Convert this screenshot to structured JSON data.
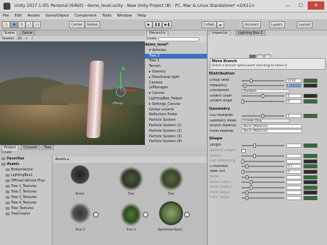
{
  "window": {
    "title": "Unity 2017.1.0f1 Personal (64bit) - demo_level.unity - New Unity Project (8) - PC, Mac & Linux Standalone* <DX11>",
    "buttons": [
      "—",
      "☐",
      "✕"
    ]
  },
  "menu": [
    "File",
    "Edit",
    "Assets",
    "GameObject",
    "Component",
    "Tools",
    "Window",
    "Help"
  ],
  "toolbar": {
    "pivot_label": "Center",
    "space_label": "Global",
    "collab_label": "Collab",
    "account_label": "Account",
    "layers_label": "Layers",
    "layout_label": "Layout"
  },
  "scene": {
    "tabs": [
      "Scene",
      "Game"
    ],
    "shading": "Shaded",
    "mode": "2D",
    "gizmo_label": "<Persp"
  },
  "hierarchy": {
    "tab": "Hierarchy",
    "create_label": "Create",
    "scene_name": "demo_level*",
    "items": [
      {
        "label": "▾ Vehicles",
        "selected": false
      },
      {
        "label": "Tree 2",
        "selected": true
      },
      {
        "label": "Tree 1",
        "selected": false
      },
      {
        "label": "Terrain",
        "selected": false
      },
      {
        "label": "▸ Scenery",
        "selected": false
      },
      {
        "label": "▸ Directional light",
        "selected": false
      },
      {
        "label": "Camera",
        "selected": false
      },
      {
        "label": "LVManager",
        "selected": false
      },
      {
        "label": "▸ Canvas",
        "selected": false
      },
      {
        "label": "LightingBox_Helper",
        "selected": false
      },
      {
        "label": "▸ Settings_Canvas",
        "selected": false
      },
      {
        "label": "Global volume",
        "selected": false
      },
      {
        "label": "Reflection Probe",
        "selected": false
      },
      {
        "label": "Particle System",
        "selected": false
      },
      {
        "label": "Particle System (1)",
        "selected": false
      },
      {
        "label": "Particle System (2)",
        "selected": false
      },
      {
        "label": "Particle System (3)",
        "selected": false
      },
      {
        "label": "Particle System (4)",
        "selected": false
      }
    ]
  },
  "inspector": {
    "tabs": [
      "Inspector",
      "Lighting Box 2"
    ],
    "branch_box": {
      "title": "Move Branch",
      "desc": "Select a branch spline point and drag to move it."
    },
    "distribution": {
      "title": "Distribution",
      "rows": [
        {
          "label": "Group Seed",
          "value": "1234",
          "kind": "slider",
          "knob": 0.2
        },
        {
          "label": "Frequency",
          "value": "1",
          "kind": "slider",
          "knob": 0.05,
          "highlight": true
        },
        {
          "label": "Distribution",
          "value": "Random",
          "kind": "dropdown"
        },
        {
          "label": "Growth Scale",
          "value": "1",
          "kind": "slider",
          "knob": 0.5
        },
        {
          "label": "Growth Angle",
          "value": "0",
          "kind": "slider",
          "knob": 0.0
        }
      ]
    },
    "geometry": {
      "title": "Geometry",
      "rows": [
        {
          "label": "LOD Multiplier",
          "value": "1",
          "kind": "slider",
          "knob": 0.5
        },
        {
          "label": "Geometry Mode",
          "value": "Fronds Only",
          "kind": "dropdown"
        },
        {
          "label": "Branch Material",
          "value": "None (Material)",
          "kind": "object"
        },
        {
          "label": "Frond Material",
          "value": "None (Material)",
          "kind": "object"
        }
      ]
    },
    "shape": {
      "title": "Shape",
      "rows": [
        {
          "label": "Length",
          "value": "",
          "kind": "slider",
          "knob": 0.3,
          "dim": false
        },
        {
          "label": "Relative Length",
          "value": "",
          "kind": "check",
          "dim": true
        },
        {
          "label": "Radius",
          "value": "",
          "kind": "slider",
          "knob": 0.3,
          "dim": true
        },
        {
          "label": "Cap Smoothing",
          "value": "",
          "kind": "slider",
          "knob": 0.0,
          "dim": true
        },
        {
          "label": "Crinkliness",
          "value": "0.1",
          "kind": "slider",
          "knob": 0.1,
          "dim": false
        },
        {
          "label": "Seek Sun",
          "value": "0",
          "kind": "slider",
          "knob": 0.0,
          "dim": false
        },
        {
          "label": "Noise",
          "value": "",
          "kind": "slider",
          "knob": 0.1,
          "dim": true
        },
        {
          "label": "Noise Scale U",
          "value": "",
          "kind": "slider",
          "knob": 0.2,
          "dim": true
        },
        {
          "label": "Noise Scale V",
          "value": "",
          "kind": "slider",
          "knob": 0.2,
          "dim": true
        },
        {
          "label": "Flare Radius",
          "value": "",
          "kind": "slider",
          "knob": 0.1,
          "dim": true
        },
        {
          "label": "Flare Height",
          "value": "",
          "kind": "slider",
          "knob": 0.1,
          "dim": true
        }
      ]
    }
  },
  "project": {
    "tabs": [
      "Project",
      "Console",
      "Tree"
    ],
    "create_label": "Create",
    "breadcrumb": "Assets ▸",
    "tree": [
      {
        "label": "Favorites",
        "level": 0
      },
      {
        "label": "Assets",
        "level": 0
      },
      {
        "label": "BrokenVector",
        "level": 1
      },
      {
        "label": "LightingBox2",
        "level": 1
      },
      {
        "label": "Offroad Vehicle Phys",
        "level": 1
      },
      {
        "label": "Tree 1_Textures",
        "level": 1
      },
      {
        "label": "Tree 2_Textures",
        "level": 1
      },
      {
        "label": "Tree 3_Textures",
        "level": 1
      },
      {
        "label": "Tree 4_Textures",
        "level": 1
      },
      {
        "label": "Tree_Textures",
        "level": 1
      },
      {
        "label": "TreeCreator",
        "level": 1
      }
    ],
    "assets": [
      {
        "label": "Brass",
        "row": 0
      },
      {
        "label": "Tree",
        "row": 0
      },
      {
        "label": "Tree",
        "row": 0
      },
      {
        "label": "Tree 2",
        "row": 1
      },
      {
        "label": "Tree 3",
        "row": 1
      },
      {
        "label": "Optimized Bark...",
        "row": 1
      }
    ]
  }
}
